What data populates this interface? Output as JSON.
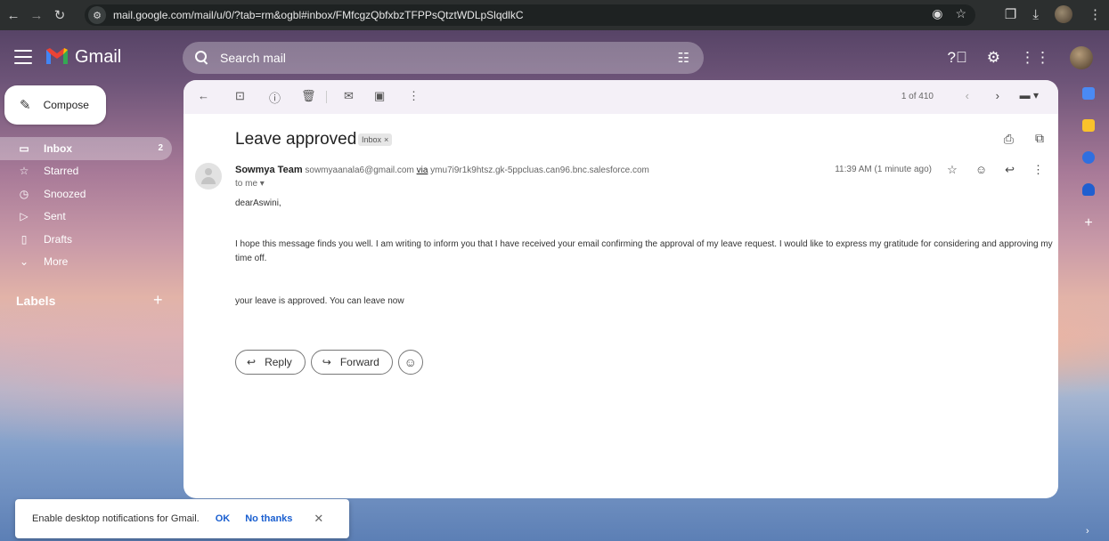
{
  "browser": {
    "url": "mail.google.com/mail/u/0/?tab=rm&ogbl#inbox/FMfcgzQbfxbzTFPPsQtztWDLpSlqdlkC"
  },
  "app": {
    "brand": "Gmail"
  },
  "search": {
    "placeholder": "Search mail"
  },
  "compose": {
    "label": "Compose"
  },
  "sidebar": {
    "items": [
      {
        "label": "Inbox",
        "count": "2",
        "icon": "inbox-icon",
        "active": true
      },
      {
        "label": "Starred",
        "icon": "star-icon"
      },
      {
        "label": "Snoozed",
        "icon": "clock-icon"
      },
      {
        "label": "Sent",
        "icon": "send-icon"
      },
      {
        "label": "Drafts",
        "icon": "draft-icon"
      },
      {
        "label": "More",
        "icon": "chevron-down-icon"
      }
    ],
    "labels_heading": "Labels"
  },
  "toolbar": {
    "count": "1 of 410"
  },
  "email": {
    "subject": "Leave approved",
    "chip": "Inbox",
    "sender_name": "Sowmya Team",
    "sender_email": "sowmyaanala6@gmail.com",
    "via_label": "via",
    "via_domain": "ymu7i9r1k9htsz.gk-5ppcluas.can96.bnc.salesforce.com",
    "to": "to me",
    "time": "11:39 AM (1 minute ago)",
    "greeting": "dearAswini,",
    "paragraph1": "I hope this message finds you well. I am writing to inform you that I have received your email confirming the approval of my leave request. I would like to express my gratitude for considering and approving my time off.",
    "paragraph2": "your leave is approved. You can leave now"
  },
  "actions": {
    "reply": "Reply",
    "forward": "Forward"
  },
  "toast": {
    "message": "Enable desktop notifications for Gmail.",
    "ok": "OK",
    "no_thanks": "No thanks"
  },
  "colors": {
    "link": "#1a5fd0",
    "browser_bar": "#2c2f2f"
  }
}
